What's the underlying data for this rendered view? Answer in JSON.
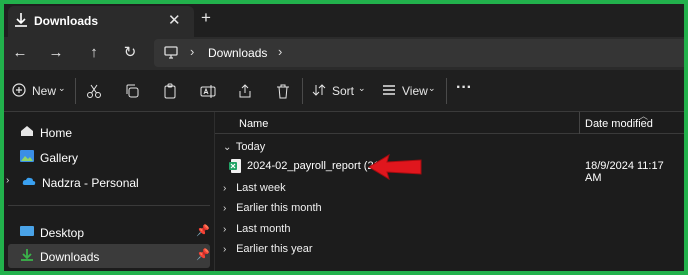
{
  "tab": {
    "title": "Downloads",
    "close": "✕",
    "new": "+"
  },
  "nav_buttons": {
    "back": "←",
    "forward": "→",
    "up": "↑",
    "refresh": "↻"
  },
  "address": {
    "separator": "›",
    "location": "Downloads"
  },
  "toolbar": {
    "new_label": "New",
    "sort_label": "Sort",
    "view_label": "View",
    "more": "···"
  },
  "sidebar": {
    "items": [
      {
        "label": "Home"
      },
      {
        "label": "Gallery"
      },
      {
        "label": "Nadzra - Personal"
      },
      {
        "label": "Desktop"
      },
      {
        "label": "Downloads"
      }
    ]
  },
  "columns": {
    "name": "Name",
    "date": "Date modified"
  },
  "groups": {
    "today": "Today",
    "last_week": "Last week",
    "earlier_month": "Earlier this month",
    "last_month": "Last month",
    "earlier_year": "Earlier this year"
  },
  "file": {
    "name": "2024-02_payroll_report (21)",
    "date": "18/9/2024 11:17 AM"
  },
  "colors": {
    "frame": "#22b14c",
    "arrow": "#e0161d",
    "excel": "#21a366"
  }
}
